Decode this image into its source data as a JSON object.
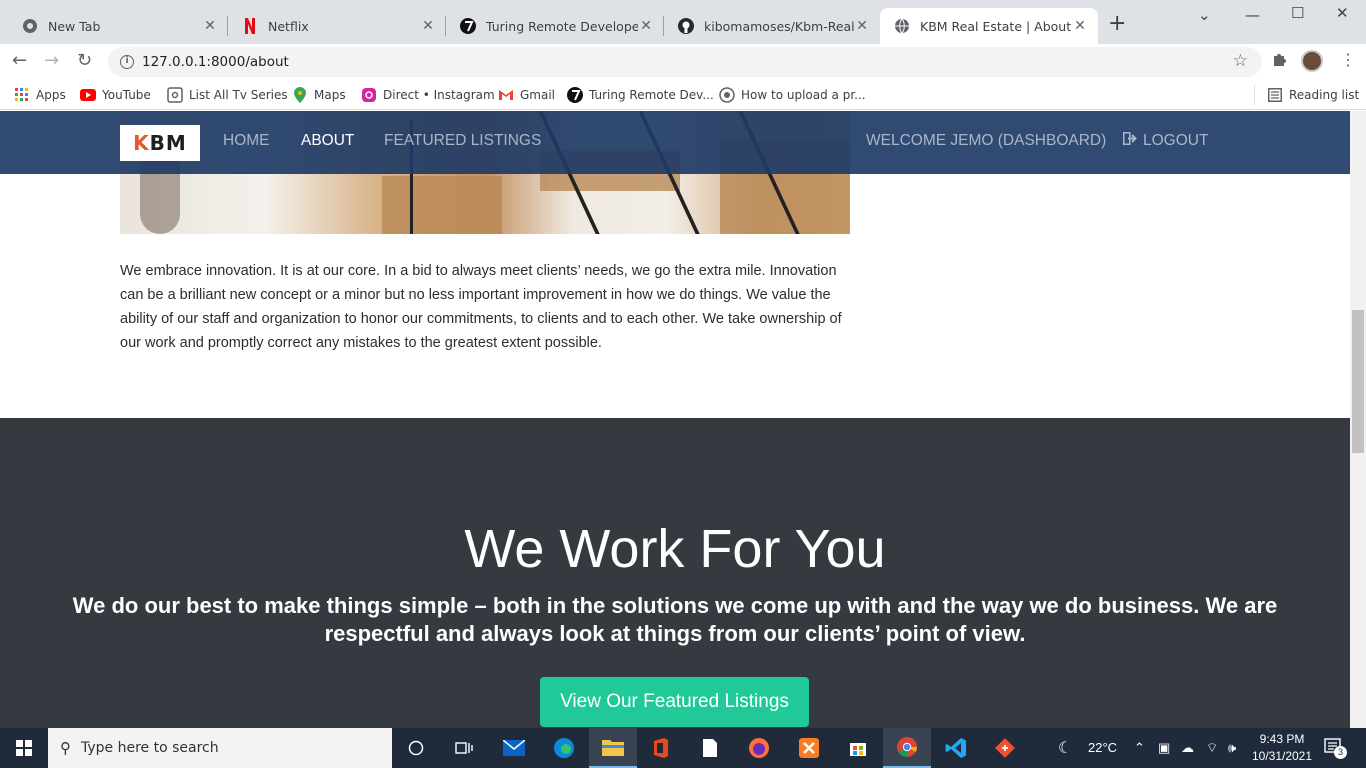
{
  "browser": {
    "tabs": [
      {
        "title": "New Tab",
        "icon": "chrome-icon"
      },
      {
        "title": "Netflix",
        "icon": "netflix-icon"
      },
      {
        "title": "Turing Remote Developer Jobs",
        "icon": "turing-icon"
      },
      {
        "title": "kibomamoses/Kbm-Real-Estate",
        "icon": "github-icon"
      },
      {
        "title": "KBM Real Estate | About",
        "icon": "globe-icon"
      }
    ],
    "url": "127.0.0.1:8000/about",
    "bookmarks": [
      {
        "label": "Apps",
        "icon": "apps-grid-icon"
      },
      {
        "label": "YouTube",
        "icon": "youtube-icon"
      },
      {
        "label": "List All Tv Series",
        "icon": "tv-icon"
      },
      {
        "label": "Maps",
        "icon": "maps-pin-icon"
      },
      {
        "label": "Direct • Instagram",
        "icon": "instagram-icon"
      },
      {
        "label": "Gmail",
        "icon": "gmail-icon"
      },
      {
        "label": "Turing Remote Dev...",
        "icon": "turing-icon"
      },
      {
        "label": "How to upload a pr...",
        "icon": "github-icon"
      }
    ],
    "reading_list": "Reading list"
  },
  "site": {
    "brand": {
      "k": "K",
      "rest": "BM"
    },
    "nav": {
      "home": "HOME",
      "about": "ABOUT",
      "featured": "FEATURED LISTINGS",
      "welcome": "WELCOME JEMO (DASHBOARD)",
      "logout": "LOGOUT"
    },
    "about_paragraph": "We embrace innovation. It is at our core. In a bid to always meet clients’ needs, we go the extra mile. Innovation can be a brilliant new concept or a minor but no less important improvement in how we do things. We value the ability of our staff and organization to honor our commitments, to clients and to each other. We take ownership of our work and promptly correct any mistakes to the greatest extent possible.",
    "work_section": {
      "heading": "We Work For You",
      "lead": "We do our best to make things simple – both in the solutions we come up with and the way we do business. We are respectful and always look at things from our clients’ point of view.",
      "cta": "View Our Featured Listings"
    },
    "colors": {
      "navbar": "#1f3b65",
      "dark_section": "#343a40",
      "cta": "#20c997",
      "brand_accent": "#e35b2c"
    }
  },
  "taskbar": {
    "search_placeholder": "Type here to search",
    "temperature": "22°C",
    "time": "9:43 PM",
    "date": "10/31/2021",
    "notifications": "3"
  }
}
